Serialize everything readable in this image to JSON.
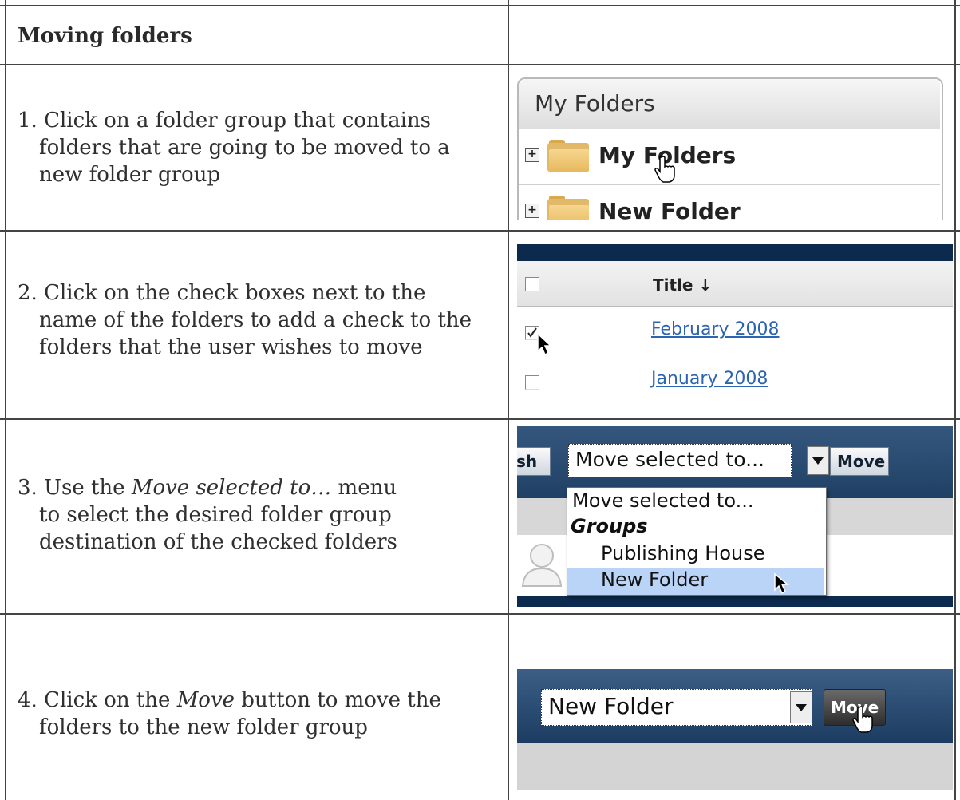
{
  "header": {
    "title": "Moving folders"
  },
  "steps": [
    {
      "line1": "1. Click on a folder group that contains",
      "line2": "folders that are going to be moved to a",
      "line3": "new folder group"
    },
    {
      "line1": "2. Click on the check boxes next to the",
      "line2": "name of the folders to add a check to the",
      "line3": "folders that the user wishes to move"
    },
    {
      "prefix": "3. Use the ",
      "italic": "Move selected to…",
      "suffix": " menu",
      "line2": "to select the desired folder group",
      "line3": "destination of the checked folders"
    },
    {
      "prefix": "4. Click on the ",
      "italic": "Move",
      "suffix": " button to move the",
      "line2": "folders to the new folder group"
    }
  ],
  "shot1": {
    "header": "My Folders",
    "items": [
      "My Folders",
      "New Folder"
    ],
    "icons": [
      "plus-icon",
      "folder-icon",
      "hand-cursor-icon"
    ]
  },
  "shot2": {
    "column_title": "Title ↓",
    "rows": [
      {
        "label": "February 2008",
        "checked": true
      },
      {
        "label": "January 2008",
        "checked": false
      }
    ]
  },
  "shot3": {
    "left_button": "sh",
    "select_value": "Move selected to...",
    "move_button": "Move",
    "menu": {
      "first_option": "Move selected to...",
      "group_label": "Groups",
      "options": [
        "Publishing House",
        "New Folder"
      ],
      "highlighted": "New Folder"
    }
  },
  "shot4": {
    "select_value": "New Folder",
    "move_button": "Move"
  },
  "colors": {
    "link": "#2b64b3",
    "nav_dark": "#0b2a4e",
    "highlight": "#b9d4f7",
    "folder": "#e7b95e"
  }
}
